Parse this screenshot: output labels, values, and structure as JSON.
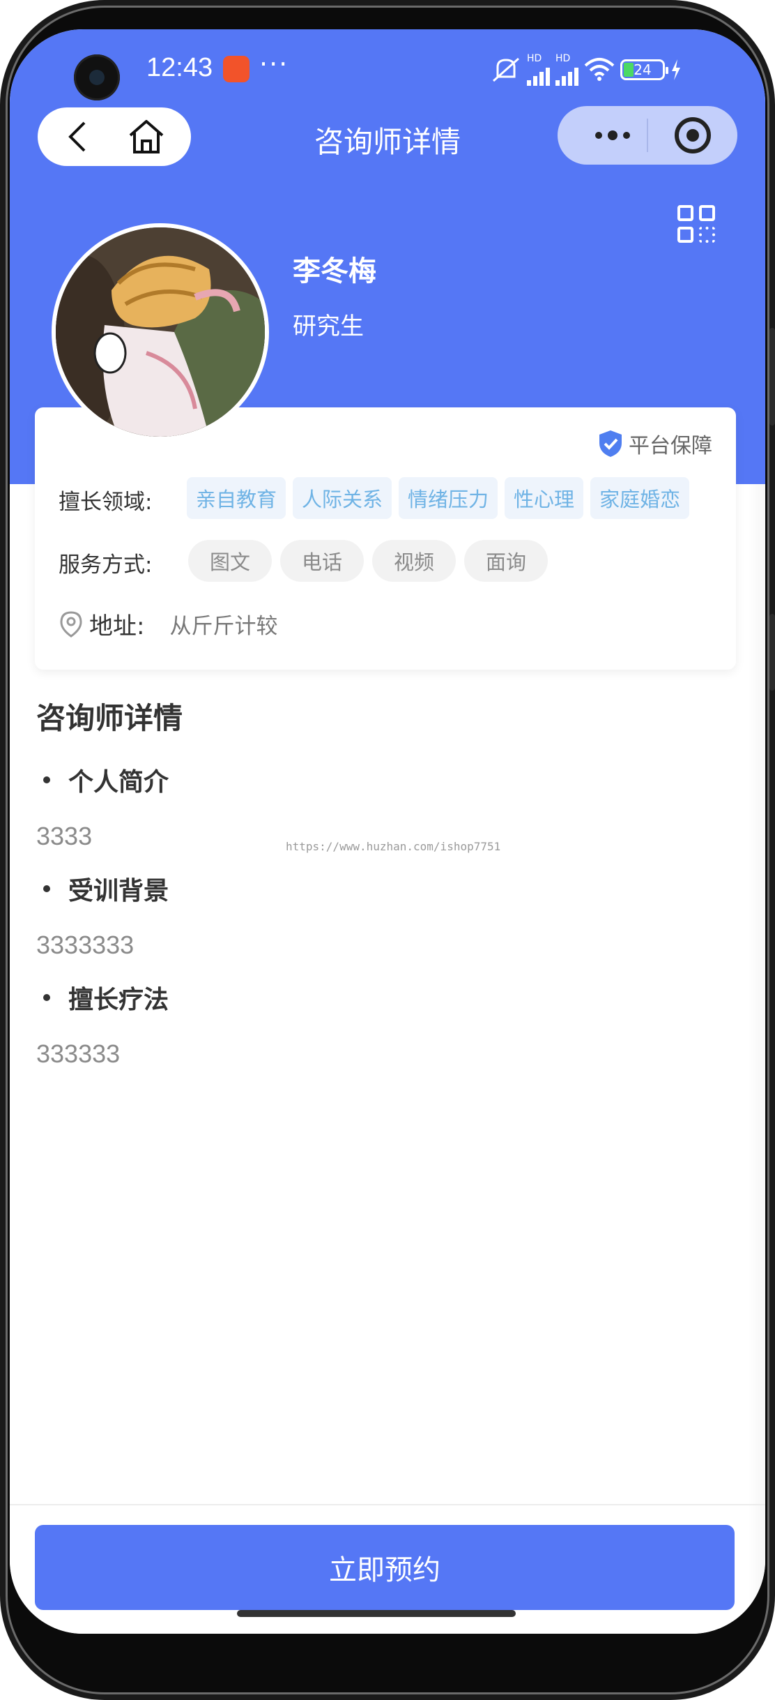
{
  "status_bar": {
    "time": "12:43",
    "dots": "···",
    "signal_label_1": "HD",
    "signal_label_2": "HD",
    "battery": "24"
  },
  "nav": {
    "title": "咨询师详情"
  },
  "profile": {
    "name": "李冬梅",
    "degree": "研究生",
    "guarantee": "平台保障"
  },
  "info": {
    "specialty_label": "擅长领域:",
    "specialties": [
      "亲自教育",
      "人际关系",
      "情绪压力",
      "性心理",
      "家庭婚恋"
    ],
    "service_label": "服务方式:",
    "services": [
      "图文",
      "电话",
      "视频",
      "面询"
    ],
    "address_label": "地址:",
    "address_value": "从斤斤计较"
  },
  "detail": {
    "title": "咨询师详情",
    "sections": [
      {
        "heading": "个人简介",
        "text": "3333"
      },
      {
        "heading": "受训背景",
        "text": "3333333"
      },
      {
        "heading": "擅长疗法",
        "text": "333333"
      }
    ],
    "watermark": "https://www.huzhan.com/ishop7751"
  },
  "actions": {
    "book_label": "立即预约"
  },
  "colors": {
    "primary": "#5577f5",
    "tag_text": "#6fb3e5",
    "tag_bg": "#eef4fc"
  }
}
